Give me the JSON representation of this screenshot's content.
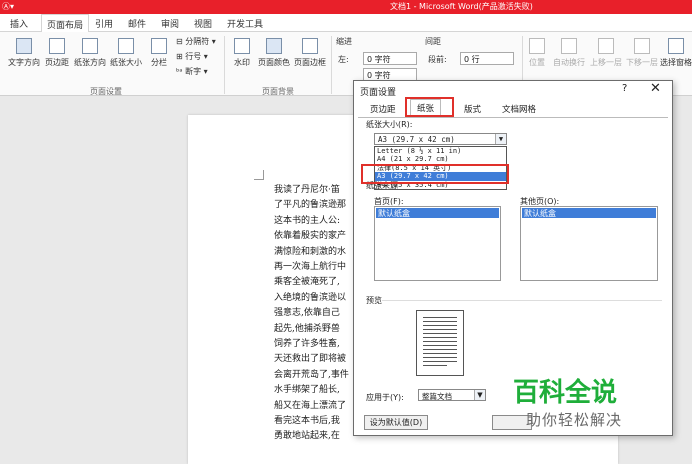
{
  "window": {
    "title": "文档1 - Microsoft Word(产品激活失败)"
  },
  "ribbon_tabs": [
    "插入",
    "页面布局",
    "引用",
    "邮件",
    "审阅",
    "视图",
    "开发工具"
  ],
  "ribbon": {
    "page_setup_buttons": [
      "文字方向",
      "页边距",
      "纸张方向",
      "纸张大小",
      "分栏"
    ],
    "page_setup_small": [
      "分隔符",
      "行号",
      "断字"
    ],
    "group_page_setup": "页面设置",
    "background_buttons": [
      "水印",
      "页面颜色",
      "页面边框"
    ],
    "group_background": "页面背景",
    "indent_label": "缩进",
    "spacing_label": "间距",
    "indent_left_label": "左:",
    "indent_left_value": "0 字符",
    "indent_right_value": "0 字符",
    "spacing_before_label": "段前:",
    "spacing_before_value": "0 行",
    "arrange_buttons": [
      "位置",
      "自动换行",
      "上移一层",
      "下移一层",
      "选择窗格"
    ]
  },
  "document": {
    "lines": [
      "我读了丹尼尔·笛",
      "了平凡的鲁滨逊那",
      "这本书的主人公:",
      "依靠着殷实的家产",
      "满惊险和刺激的水",
      "再一次海上航行中",
      "乘客全被淹死了,",
      "入绝境的鲁滨逊以",
      "强意志,依靠自己",
      "起先,他捕杀野兽",
      "饲养了许多牲畜,",
      "天还救出了即将被",
      "会离开荒岛了,事件",
      "水手绑架了船长,",
      "船又在海上漂流了",
      "看完这本书后,我",
      "勇敢地站起来,在"
    ]
  },
  "dialog": {
    "title": "页面设置",
    "help": "?",
    "close": "✕",
    "tabs": [
      "页边距",
      "纸张",
      "版式",
      "文档网格"
    ],
    "paper_size_label": "纸张大小(R):",
    "paper_size_value": "A3 (29.7 x 42 cm)",
    "paper_options": [
      "Letter (8 ½ x 11 in)",
      "A4 (21 x 29.7 cm)",
      "法律(8.5 x 14 英寸)",
      "A3 (29.7 x 42 cm)",
      "B4 (25 x 35.4 cm)"
    ],
    "selected_option_index": 3,
    "paper_source_label": "纸张来源",
    "first_page_label": "首页(F):",
    "first_page_value": "默认纸盒",
    "other_pages_label": "其他页(O):",
    "other_pages_value": "默认纸盒",
    "preview_label": "预览",
    "apply_to_label": "应用于(Y):",
    "apply_to_value": "整篇文档",
    "default_button": "设为默认值(D)"
  },
  "watermark": {
    "brand": "百科全说",
    "sub": "助你轻松解决"
  },
  "colors": {
    "title_bar": "#e8202a",
    "highlight_box": "#e0302a",
    "selection": "#3f7dd8",
    "watermark_brand": "#1fae3a"
  }
}
